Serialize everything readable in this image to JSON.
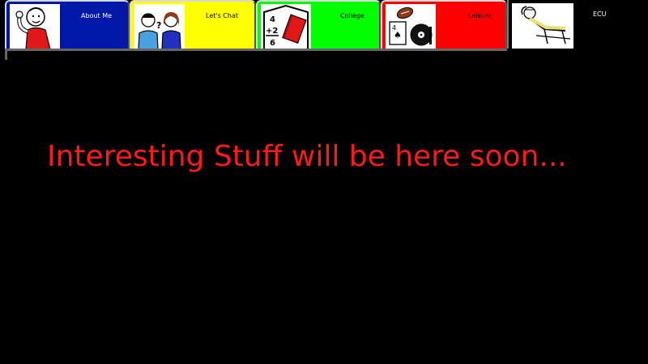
{
  "tabs": [
    {
      "key": "about",
      "label": "About Me",
      "icon": "person-waving-icon",
      "bg": "#0018a8",
      "text_color": "#ffffff"
    },
    {
      "key": "chat",
      "label": "Let's Chat",
      "icon": "two-people-talking-icon",
      "bg": "#ffff00",
      "text_color": "#000000"
    },
    {
      "key": "college",
      "label": "College",
      "icon": "math-book-icon",
      "bg": "#00ff00",
      "text_color": "#000000"
    },
    {
      "key": "leisure",
      "label": "Leisure",
      "icon": "games-music-icon",
      "bg": "#ff0000",
      "text_color": "#000000"
    },
    {
      "key": "ecu",
      "label": "ECU",
      "icon": "relaxing-person-icon",
      "bg": "#000000",
      "text_color": "#ffffff"
    }
  ],
  "main": {
    "message": "Interesting Stuff will be here soon...",
    "message_color": "#ff1a1a"
  }
}
